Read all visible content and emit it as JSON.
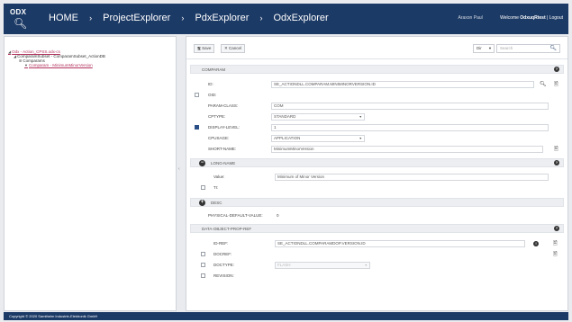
{
  "header": {
    "logo_text": "ODX",
    "breadcrumbs": [
      "HOME",
      "ProjectExplorer",
      "PdxExplorer",
      "OdxExplorer"
    ],
    "separator": "›",
    "username": "Araxon Paul",
    "welcome_prefix": "Welcome",
    "welcome_user": "OdxuqRtest",
    "logout_label": "| Logout"
  },
  "tree": {
    "items": [
      {
        "twisty": "◢",
        "label": "Odx - Action_CPSS.odx-cs"
      },
      {
        "twisty": "◢",
        "label": "ComparamSubset - ComparamSubset_ActionDB"
      },
      {
        "twisty": "⊞",
        "label": "Comparams"
      },
      {
        "twisty": "▼",
        "label": "Comparam - MinimumMinorVersion"
      }
    ]
  },
  "toolbar": {
    "save_label": "Save",
    "cancel_label": "Cancel",
    "filter_value": "Dir",
    "search_placeholder": "Search"
  },
  "comparam": {
    "section_title": "COMPARAM",
    "id_label": "ID:",
    "id_value": "SE_ACTIONDLL.COMPARAM.MINIMINORVERSION.ID",
    "oid_label": "OID:",
    "param_class_label": "PARAM-CLASS:",
    "param_class_value": "COM",
    "cptype_label": "CPTYPE:",
    "cptype_value": "STANDARD",
    "display_level_label": "DISPLAY-LEVEL:",
    "display_level_value": "1",
    "cpusage_label": "CPUSAGE:",
    "cpusage_value": "APPLICATION",
    "short_name_label": "SHORT-NAME:",
    "short_name_value": "MinimumMinorVersion"
  },
  "long_name": {
    "section_title": "LONG-NAME",
    "value_label": "Value:",
    "value": "Minimum of Minor Version",
    "ti_label": "TI:"
  },
  "desc": {
    "section_title": "DESC"
  },
  "physical_default": {
    "label": "PHYSICAL-DEFAULT-VALUE:",
    "value": "0"
  },
  "data_object_prop_ref": {
    "section_title": "DATA-OBJECT-PROP-REF",
    "id_ref_label": "ID-REF:",
    "id_ref_value": "SE_ACTIONDLL.COMPARAMDOP.VERSION.ID",
    "docref_label": "DOCREF:",
    "doctype_label": "DOCTYPE:",
    "doctype_value": "FLASH",
    "revision_label": "REVISION:"
  },
  "footer": {
    "copyright": "Copyright © 2020 Samtheim Industrie-Elektronik GmbH"
  },
  "colors": {
    "header_bg": "#1c3a66",
    "link": "#b2325c",
    "checkbox_on": "#2a4f86"
  }
}
